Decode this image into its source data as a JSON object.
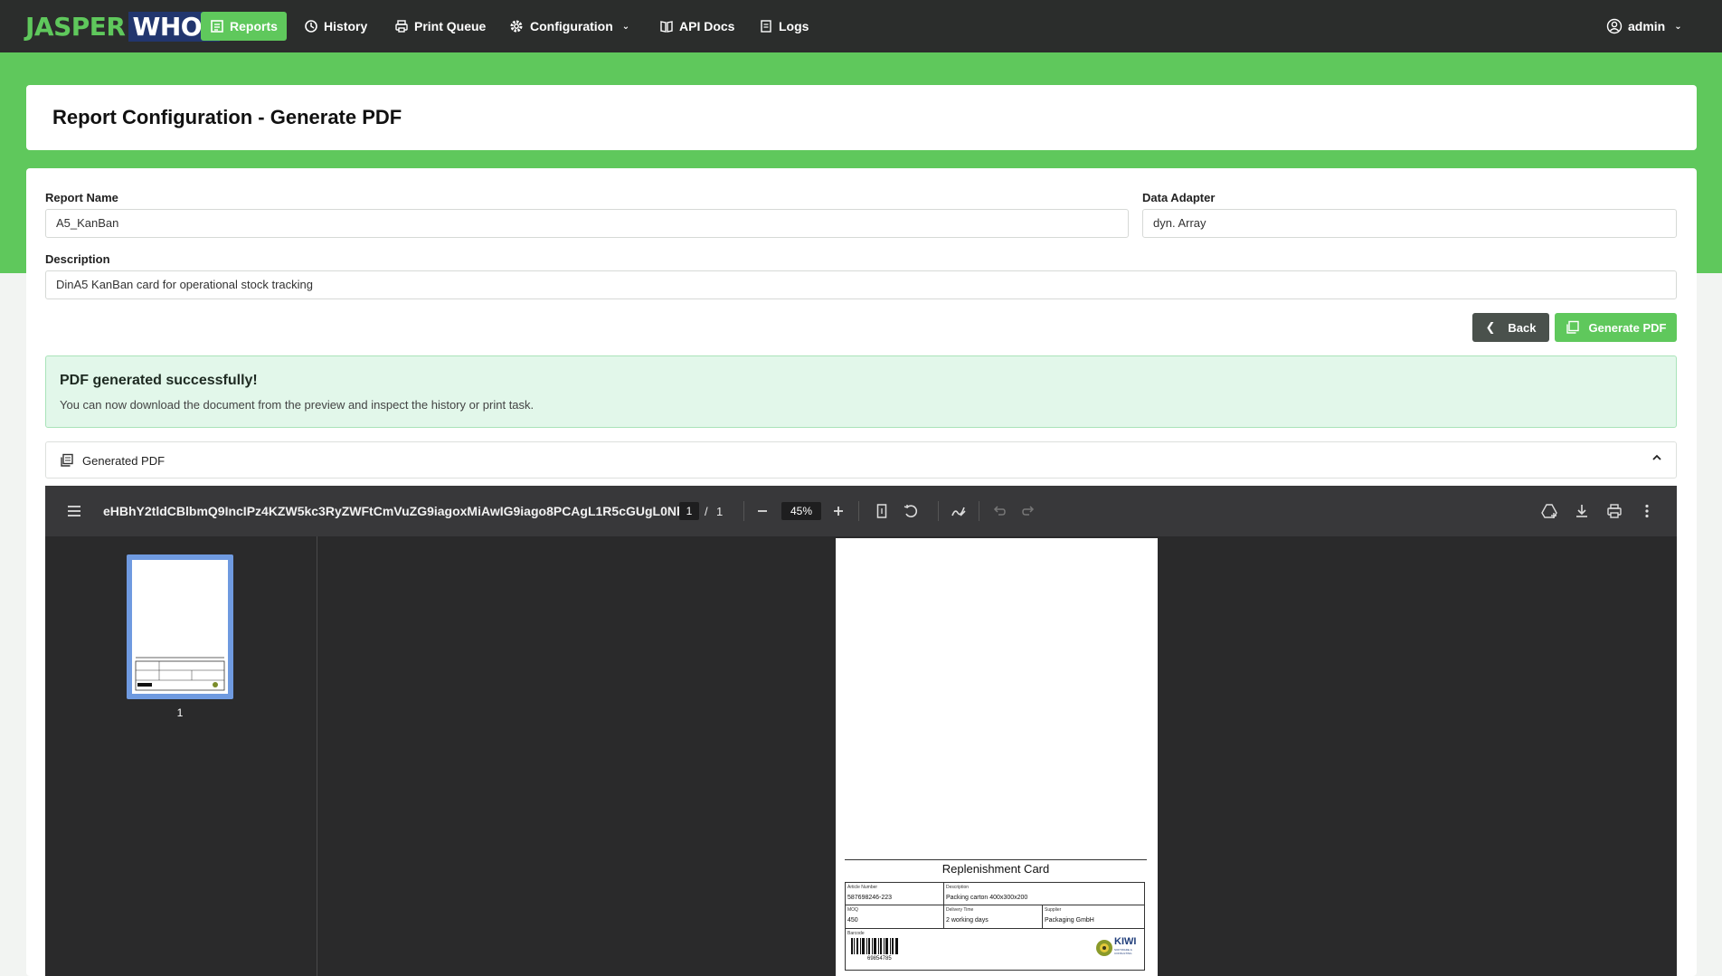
{
  "nav": {
    "logo_a": "JASPER",
    "logo_b": "WHO?",
    "items": [
      {
        "label": "Reports",
        "icon": "report-icon",
        "active": true
      },
      {
        "label": "History",
        "icon": "history-icon"
      },
      {
        "label": "Print Queue",
        "icon": "printer-icon"
      },
      {
        "label": "Configuration",
        "icon": "gear-icon"
      },
      {
        "label": "API Docs",
        "icon": "book-icon"
      },
      {
        "label": "Logs",
        "icon": "logs-icon"
      }
    ],
    "user": "admin"
  },
  "page": {
    "title": "Report Configuration - Generate PDF"
  },
  "form": {
    "report_name_label": "Report Name",
    "report_name_value": "A5_KanBan",
    "data_adapter_label": "Data Adapter",
    "data_adapter_value": "dyn. Array",
    "description_label": "Description",
    "description_value": "DinA5 KanBan card for operational stock tracking",
    "back_label": "Back",
    "generate_label": "Generate PDF"
  },
  "alert": {
    "title": "PDF generated successfully!",
    "message": "You can now download the document from the preview and inspect the history or print task."
  },
  "accordion": {
    "title": "Generated PDF"
  },
  "viewer": {
    "filename": "eHBhY2tldCBlbmQ9IncIPz4KZW5kc3RyZWFtCmVuZG9iagoxMiAwIG9iago8PCAgL1R5cGUgL0Nh...",
    "page_current": "1",
    "page_sep": "/",
    "page_total": "1",
    "zoom": "45%",
    "thumb_label": "1"
  },
  "pdf": {
    "title": "Replenishment Card",
    "article_number_label": "Article Number",
    "article_number": "587698246-223",
    "description_label": "Description",
    "description": "Packing carton 400x300x200",
    "moq_label": "MOQ",
    "moq": "450",
    "delivery_label": "Delivery Time",
    "delivery": "2 working days",
    "supplier_label": "Supplier",
    "supplier": "Packaging GmbH",
    "barcode_label": "Barcode",
    "barcode_number": "69854785",
    "logo_text": "KIWI",
    "logo_sub": "SOFTWARE & CONSULTING"
  },
  "colors": {
    "accent": "#5fc85c",
    "nav_bg": "#2b2d2c",
    "viewer_bg": "#2a2a2b"
  }
}
